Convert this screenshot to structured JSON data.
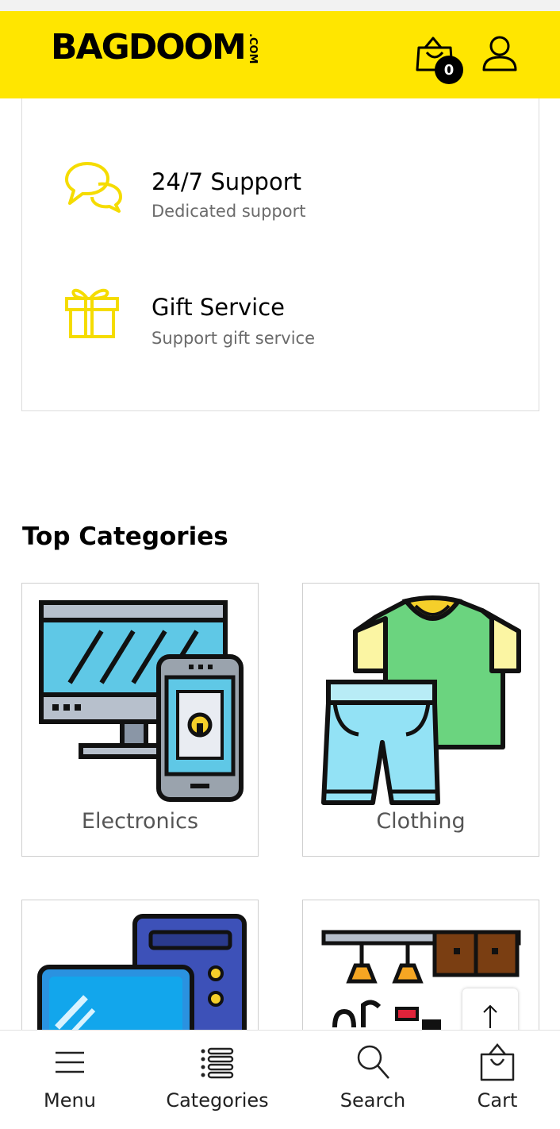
{
  "header": {
    "logo_text": "BAGDOOM",
    "logo_suffix": ".COM",
    "cart_count": "0",
    "background": "#ffe600"
  },
  "features": [
    {
      "title": "24/7 Support",
      "subtitle": "Dedicated support",
      "icon": "chat-bubbles-icon"
    },
    {
      "title": "Gift Service",
      "subtitle": "Support gift service",
      "icon": "gift-icon"
    }
  ],
  "top_categories": {
    "title": "Top Categories",
    "items": [
      {
        "label": "Electronics",
        "icon": "monitor-phone-icon"
      },
      {
        "label": "Clothing",
        "icon": "tshirt-shorts-icon"
      },
      {
        "label": "",
        "icon": "computer-icon"
      },
      {
        "label": "",
        "icon": "home-furniture-icon"
      }
    ]
  },
  "bottom_nav": [
    {
      "label": "Menu",
      "icon": "hamburger-menu-icon"
    },
    {
      "label": "Categories",
      "icon": "list-icon"
    },
    {
      "label": "Search",
      "icon": "search-icon"
    },
    {
      "label": "Cart",
      "icon": "shopping-bag-icon"
    }
  ],
  "colors": {
    "accent": "#ffe600",
    "icon_yellow": "#f5dc00"
  }
}
